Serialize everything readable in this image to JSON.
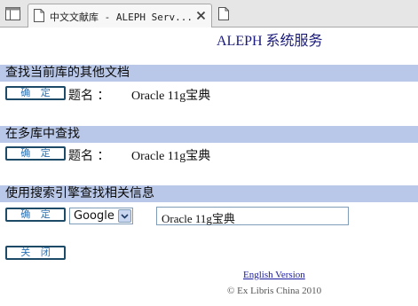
{
  "browser": {
    "tab_title": "中文文献库 - ALEPH Serv..."
  },
  "page": {
    "title": "ALEPH 系统服务"
  },
  "sections": [
    {
      "heading": "查找当前库的其他文档",
      "button_label": "确 定",
      "field_label": "题名 ：",
      "field_value": "Oracle 11g宝典"
    },
    {
      "heading": "在多库中查找",
      "button_label": "确 定",
      "field_label": "题名 ：",
      "field_value": "Oracle 11g宝典"
    },
    {
      "heading": "使用搜索引擎查找相关信息",
      "button_label": "确 定",
      "engine_selected": "Google",
      "search_value": "Oracle 11g宝典"
    }
  ],
  "close_button_label": "关 闭",
  "footer": {
    "english_link": "English Version",
    "copyright": "© Ex Libris China 2010"
  },
  "colors": {
    "section_bar": "#b9c8e8",
    "button_border": "#1d4a66",
    "button_text": "#2a6fb0",
    "link": "#1a1aa0"
  },
  "icons": [
    "tab-list-icon",
    "page-icon",
    "close-icon",
    "new-tab-icon",
    "dropdown-arrow-icon"
  ]
}
